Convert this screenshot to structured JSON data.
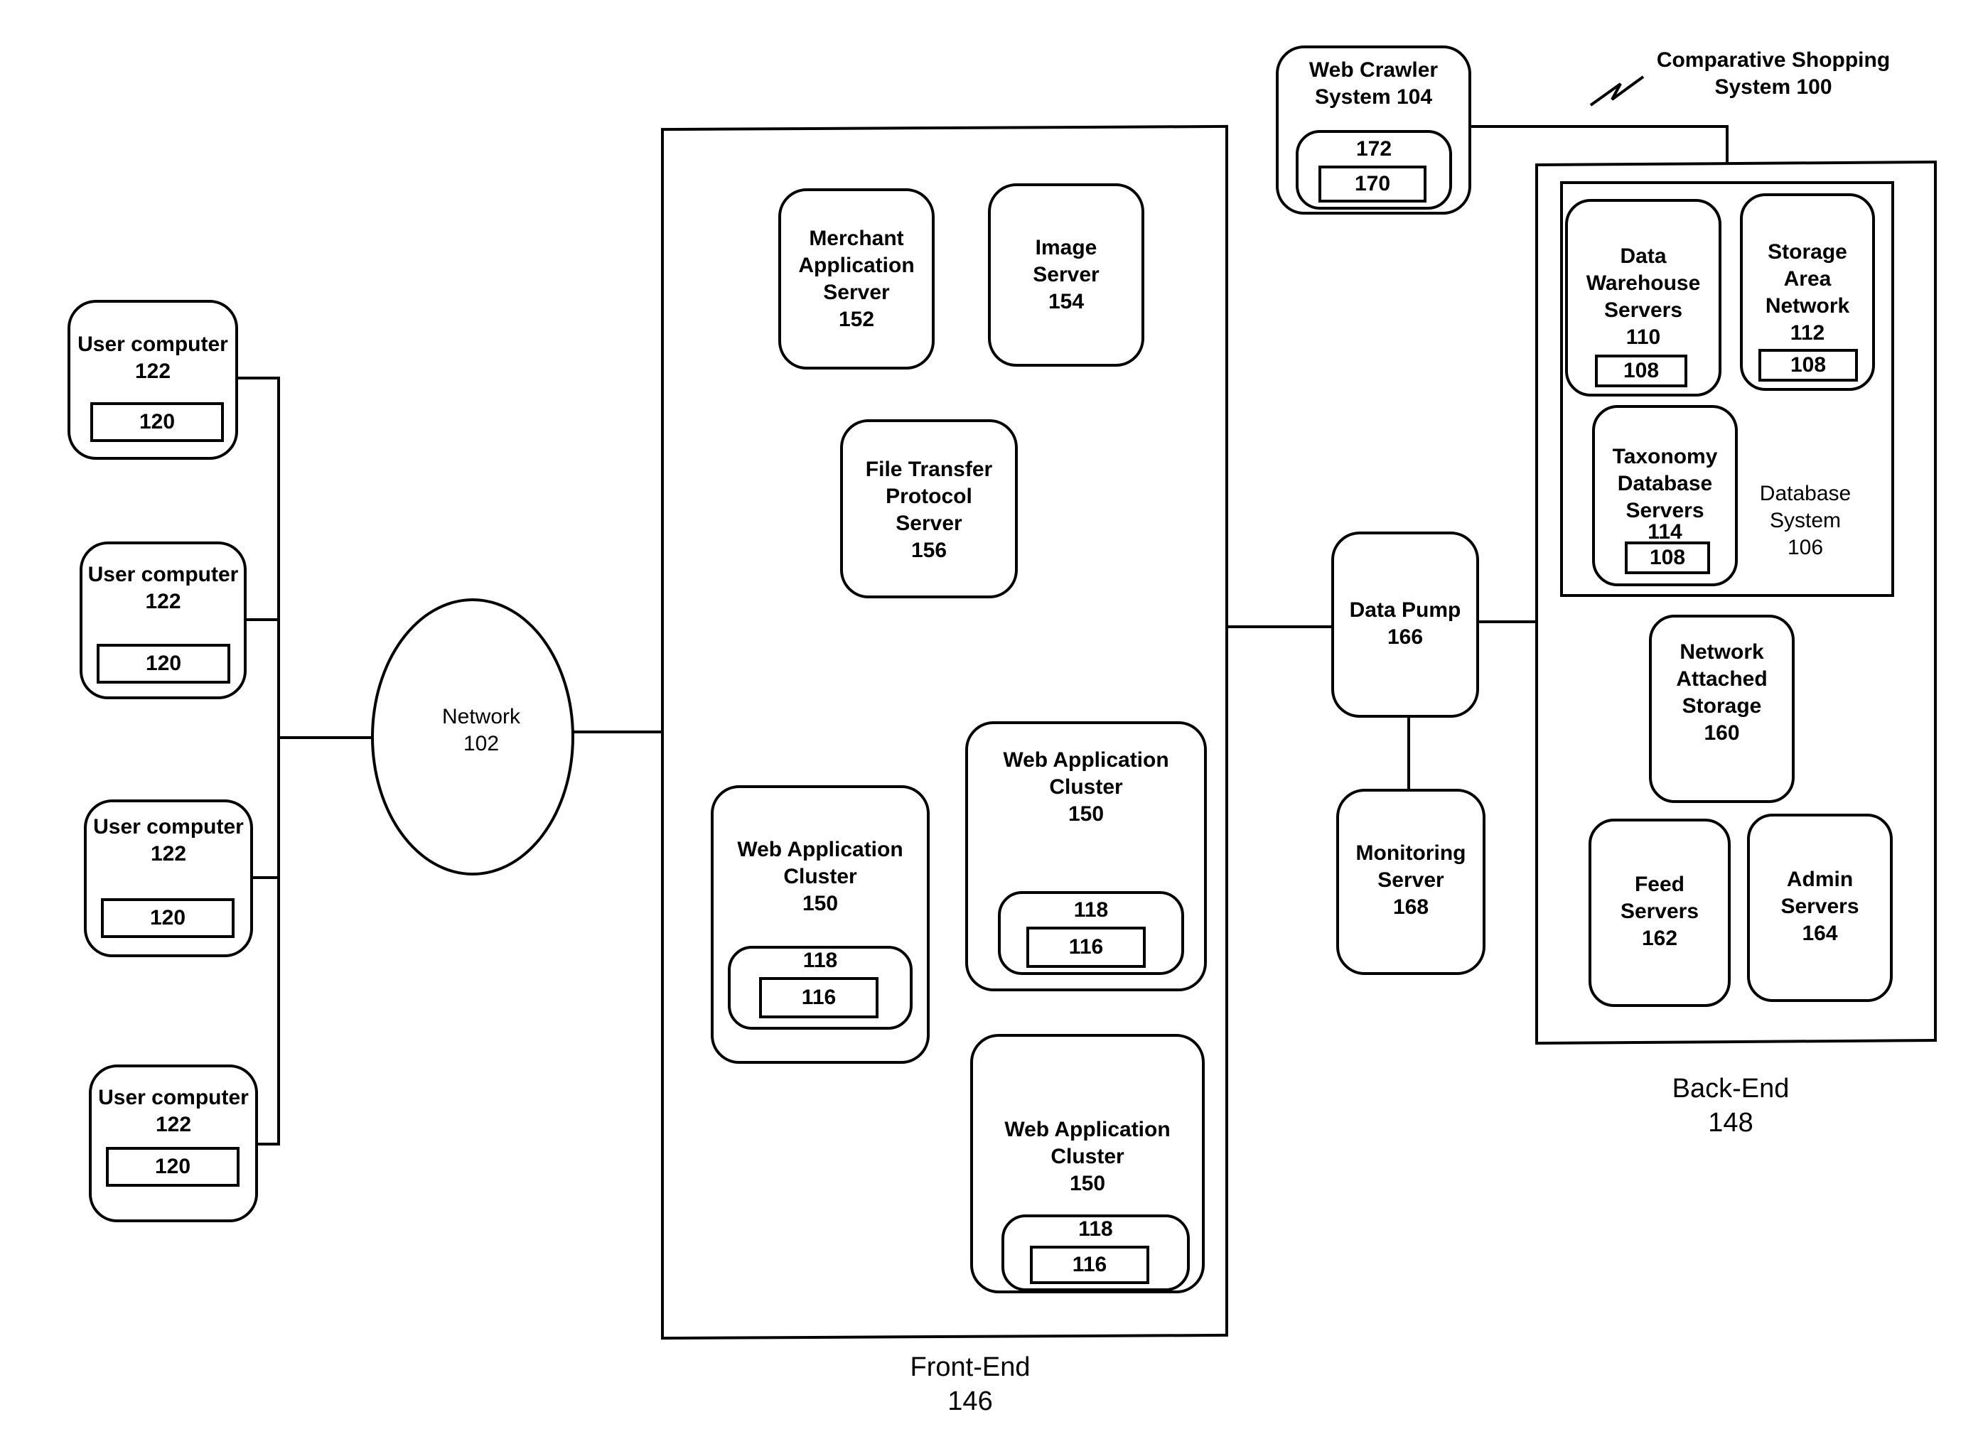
{
  "title": "Comparative Shopping System 100",
  "system_label": [
    "Comparative Shopping",
    "System 100"
  ],
  "user_computers": [
    {
      "label": "User computer",
      "ref": "122",
      "inner": "120"
    },
    {
      "label": "User computer",
      "ref": "122",
      "inner": "120"
    },
    {
      "label": "User computer",
      "ref": "122",
      "inner": "120"
    },
    {
      "label": "User computer",
      "ref": "122",
      "inner": "120"
    }
  ],
  "network": {
    "label": "Network",
    "ref": "102"
  },
  "front_end": {
    "label": "Front-End",
    "ref": "146",
    "merchant_app_server": {
      "lines": [
        "Merchant",
        "Application",
        "Server"
      ],
      "ref": "152"
    },
    "image_server": {
      "lines": [
        "Image",
        "Server"
      ],
      "ref": "154"
    },
    "ftp_server": {
      "lines": [
        "File Transfer",
        "Protocol",
        "Server"
      ],
      "ref": "156"
    },
    "web_clusters": [
      {
        "lines": [
          "Web Application",
          "Cluster"
        ],
        "ref": "150",
        "outer": "118",
        "inner": "116"
      },
      {
        "lines": [
          "Web Application",
          "Cluster"
        ],
        "ref": "150",
        "outer": "118",
        "inner": "116"
      },
      {
        "lines": [
          "Web Application",
          "Cluster"
        ],
        "ref": "150",
        "outer": "118",
        "inner": "116"
      }
    ]
  },
  "web_crawler": {
    "lines": [
      "Web Crawler",
      "System 104"
    ],
    "outer": "172",
    "inner": "170"
  },
  "data_pump": {
    "lines": [
      "Data Pump"
    ],
    "ref": "166"
  },
  "monitoring_server": {
    "lines": [
      "Monitoring",
      "Server"
    ],
    "ref": "168"
  },
  "back_end": {
    "label": "Back-End",
    "ref": "148",
    "database_system": {
      "lines": [
        "Database",
        "System"
      ],
      "ref": "106"
    },
    "data_warehouse": {
      "lines": [
        "Data",
        "Warehouse",
        "Servers"
      ],
      "ref": "110",
      "inner": "108"
    },
    "storage_area_network": {
      "lines": [
        "Storage",
        "Area",
        "Network"
      ],
      "ref": "112",
      "inner": "108"
    },
    "taxonomy_db": {
      "lines": [
        "Taxonomy",
        "Database",
        "Servers"
      ],
      "ref": "114",
      "inner": "108"
    },
    "nas": {
      "lines": [
        "Network",
        "Attached",
        "Storage"
      ],
      "ref": "160"
    },
    "feed_servers": {
      "lines": [
        "Feed",
        "Servers"
      ],
      "ref": "162"
    },
    "admin_servers": {
      "lines": [
        "Admin",
        "Servers"
      ],
      "ref": "164"
    }
  }
}
